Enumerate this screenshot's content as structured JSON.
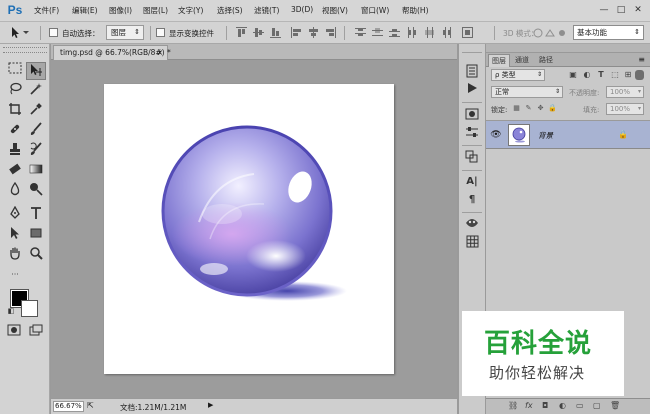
{
  "app": {
    "logo": "Ps"
  },
  "menu": [
    "文件(F)",
    "编辑(E)",
    "图像(I)",
    "图层(L)",
    "文字(Y)",
    "选择(S)",
    "滤镜(T)",
    "3D(D)",
    "视图(V)",
    "窗口(W)",
    "帮助(H)"
  ],
  "window_controls": {
    "minimize": "—",
    "maximize": "□",
    "close": "✕"
  },
  "options": {
    "auto_select_label": "自动选择：",
    "auto_select_value": "图层",
    "show_transform_label": "显示变换控件",
    "mode3d_label": "3D 模式：",
    "workspace": "基本功能"
  },
  "document": {
    "tab_title": "timg.psd @ 66.7%(RGB/8#) *",
    "close_glyph": "×",
    "zoom": "66.67%",
    "doc_info": "文档:1.21M/1.21M"
  },
  "layers_panel": {
    "tabs": [
      "图层",
      "通道",
      "路径"
    ],
    "filter_type": "ρ 类型",
    "blend_mode": "正常",
    "opacity_label": "不透明度:",
    "opacity_value": "100%",
    "lock_label": "锁定:",
    "fill_label": "填充:",
    "fill_value": "100%",
    "layers": [
      {
        "name": "背景"
      }
    ]
  },
  "watermark": {
    "title": "百科全说",
    "subtitle": "助你轻松解决"
  }
}
